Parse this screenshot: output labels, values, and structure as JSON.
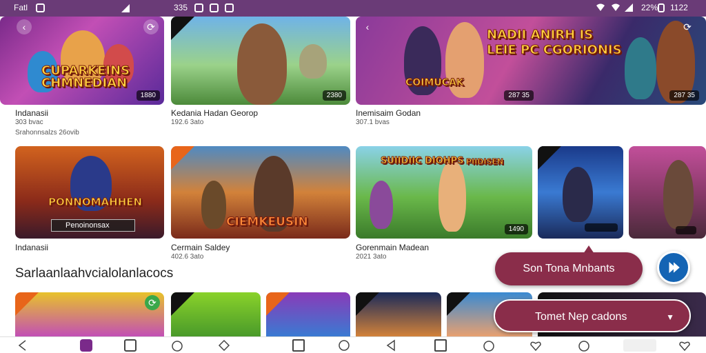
{
  "status_bar": {
    "left": "Fatl",
    "time_left": "335",
    "right": "22%",
    "time_right": "1122"
  },
  "row1": [
    {
      "title": "Indanasii",
      "sub1": "303 bvac",
      "sub2": "Srahonnsalzs 26ovib",
      "badge": "1880",
      "art_title": "CUPARKEINS CHMNEDIAN"
    },
    {
      "title": "Kedania Hadan Georop",
      "sub1": "192.6 3ato",
      "badge": "2380",
      "art_title": ""
    },
    {
      "title": "Inemisaim Godan",
      "sub1": "307.1 bvas",
      "badge": "287 35",
      "art_title": "NADII ANIRH IS LEIE PC CGORIONIS",
      "art_title2": "COIMUCAK"
    }
  ],
  "row2": [
    {
      "title": "Indanasii",
      "badge": "",
      "art_title": "PONNOMAHHEN",
      "overlay": "Penoinonsax"
    },
    {
      "title": "Cermain Saldey",
      "sub1": "402.6 3ato",
      "art_title": "CIEMKEUSIN"
    },
    {
      "title": "Gorenmain Madean",
      "sub1": "2021 3ato",
      "badge": "1490",
      "art_title": "SUIIDIIC DIOHPS",
      "art_title2": "PIIDISEN"
    },
    {
      "badge": "",
      "label": ""
    },
    {
      "badge": ""
    }
  ],
  "section_title": "Sarlaanlaahvcialolanlacocs",
  "row3_count": 6,
  "pill1": "Son Tona Mnbants",
  "pill2": "Tomet Nep cadons",
  "colors": {
    "statusbar": "#6a3b77",
    "pill": "#8a2d4a",
    "fab": "#1464b4"
  },
  "nav_icons": [
    "back-icon",
    "game-icon",
    "library-icon",
    "apple-icon",
    "tag-icon",
    "square-icon",
    "circle-icon",
    "back-icon",
    "square-icon",
    "apple-icon",
    "heart-icon",
    "apple-icon",
    "app-icon",
    "heart-icon"
  ]
}
